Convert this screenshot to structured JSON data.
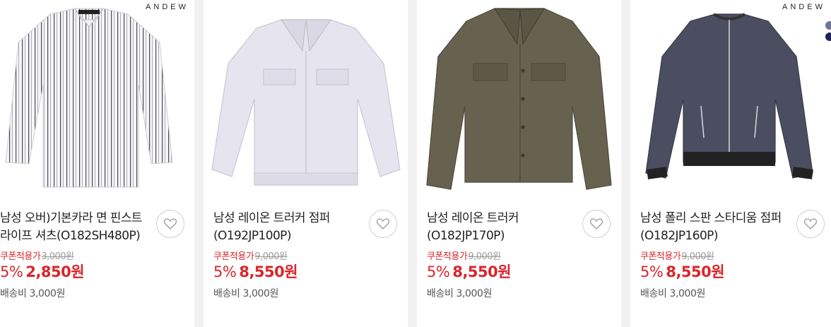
{
  "products": [
    {
      "brand": "ANDEW",
      "title": "남성 오버)기본카라 면 핀스트\n라이프 셔츠(O182SH480P)",
      "coupon_label": "쿠폰적용가",
      "original_price": "3,000원",
      "discount": "5%",
      "sale_price": "2,850원",
      "shipping": "배송비 3,000원",
      "image": "white-striped-shirt"
    },
    {
      "brand": "",
      "title": "남성 레이온 트러커 점퍼\n(O192JP100P)",
      "coupon_label": "쿠폰적용가",
      "original_price": "9,000원",
      "discount": "5%",
      "sale_price": "8,550원",
      "shipping": "배송비 3,000원",
      "image": "lavender-jacket"
    },
    {
      "brand": "",
      "title": "남성 레이온 트러커\n(O182JP170P)",
      "coupon_label": "쿠폰적용가",
      "original_price": "9,000원",
      "discount": "5%",
      "sale_price": "8,550원",
      "shipping": "배송비 3,000원",
      "image": "khaki-jacket"
    },
    {
      "brand": "ANDEW",
      "title": "남성 폴리 스판 스타디움 점퍼\n(O182JP160P)",
      "coupon_label": "쿠폰적용가",
      "original_price": "9,000원",
      "discount": "5%",
      "sale_price": "8,550원",
      "shipping": "배송비 3,000원",
      "image": "navy-stadium-jacket",
      "color_swatches": [
        "#6e7399",
        "#1f2456"
      ]
    }
  ],
  "icons": {
    "wishlist": "heart-icon"
  },
  "colors": {
    "price": "#d8262c",
    "strike": "#9a9a9a",
    "background": "#f1f1f1"
  }
}
